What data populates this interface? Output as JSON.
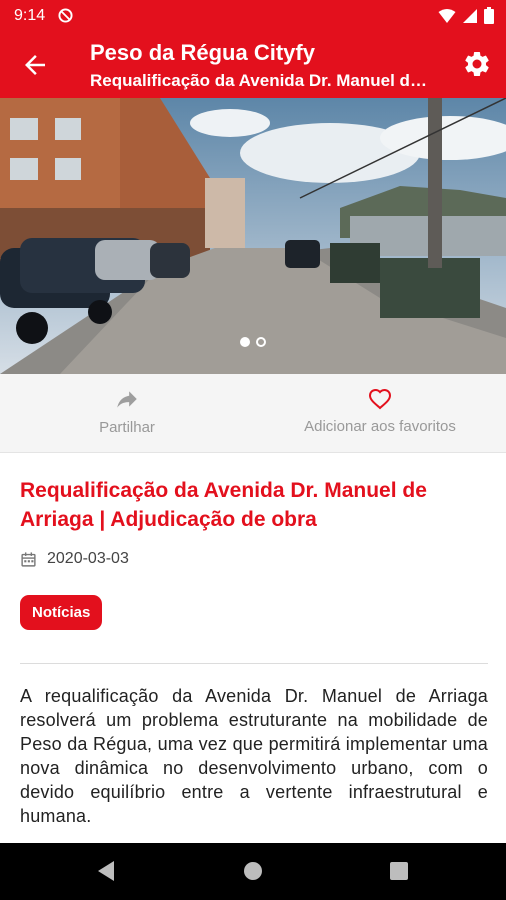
{
  "status_bar": {
    "time": "9:14"
  },
  "app_bar": {
    "title": "Peso da Régua Cityfy",
    "subtitle": "Requalificação da Avenida Dr. Manuel de Arriaga | Adjudicação de obra"
  },
  "actions": {
    "share_label": "Partilhar",
    "favorite_label": "Adicionar aos favoritos"
  },
  "article": {
    "title": "Requalificação da Avenida Dr. Manuel de Arriaga | Adjudicação de obra",
    "date": "2020-03-03",
    "tag": "Notícias",
    "body": "A requalificação da Avenida Dr. Manuel de Arriaga resolverá um problema estruturante na mobilidade de Peso da Régua, uma vez que permitirá implementar uma nova dinâmica no desenvolvimento urbano, com o devido equilíbrio entre a vertente infraestrutural e humana."
  },
  "carousel": {
    "image_count": 2,
    "active_index": 1
  },
  "colors": {
    "brand": "#e3101d",
    "action_gray": "#9e9e9e"
  },
  "icons": [
    "dnd-icon",
    "wifi-icon",
    "signal-icon",
    "battery-icon",
    "back-arrow-icon",
    "gear-icon",
    "share-icon",
    "heart-outline-icon",
    "calendar-icon",
    "nav-back-icon",
    "nav-home-icon",
    "nav-recents-icon"
  ]
}
